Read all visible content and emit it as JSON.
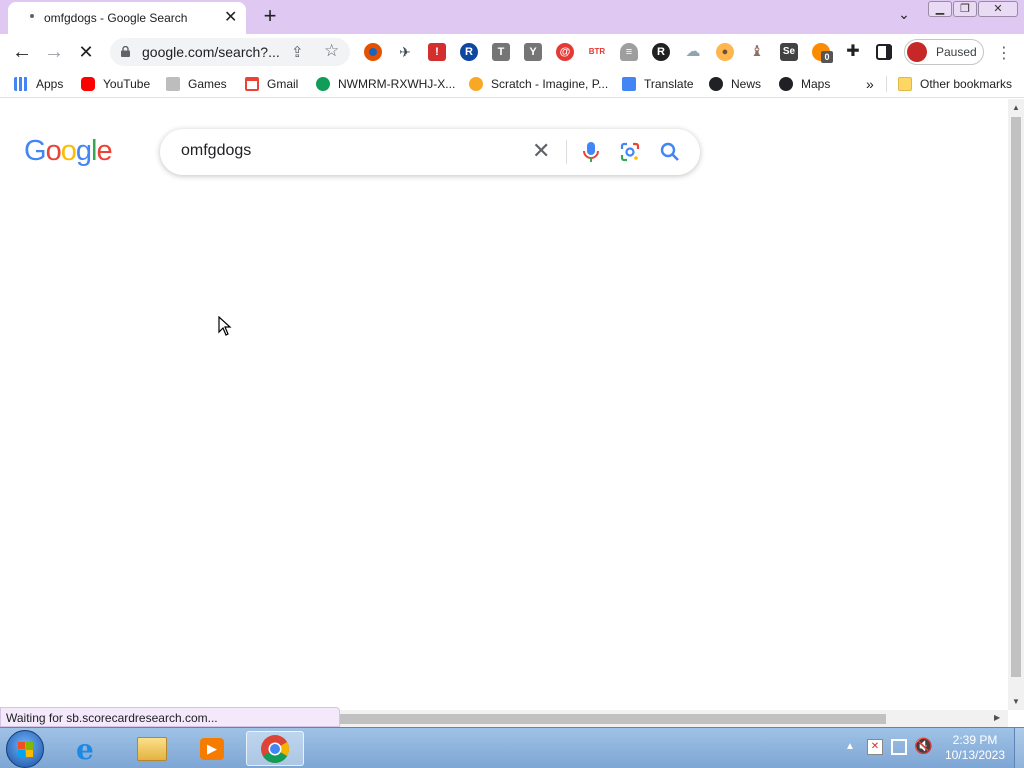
{
  "browser": {
    "tab": {
      "title": "omfgdogs - Google Search",
      "close_glyph": "✕"
    },
    "new_tab_glyph": "+",
    "tab_search_glyph": "⌄",
    "address": {
      "url": "google.com/search?..."
    },
    "profile": {
      "label": "Paused"
    },
    "extensions": [
      "eye-extension",
      "vimeo-extension",
      "red-alert-extension",
      "r-circle-extension",
      "t-extension",
      "y-extension",
      "red-swirl-extension",
      "btr-extension",
      "stack-extension",
      "r-black-extension",
      "cloud-extension",
      "cookie-extension",
      "chess-extension",
      "selenium-extension",
      "badge-extension",
      "puzzle-icon",
      "side-panel-icon"
    ],
    "extension_badge": "0",
    "selenium_label": "Se",
    "btr_label": "BTR",
    "t_label": "T",
    "y_label": "Y",
    "r_label": "R"
  },
  "bookmarks": {
    "items": [
      {
        "label": "Apps",
        "icon": "apps-grid-icon",
        "color": "#4285f4"
      },
      {
        "label": "YouTube",
        "icon": "youtube-icon",
        "color": "#ff0000"
      },
      {
        "label": "Games",
        "icon": "games-icon",
        "color": "#9e9e9e"
      },
      {
        "label": "Gmail",
        "icon": "gmail-icon",
        "color": "#ea4335"
      },
      {
        "label": "NWMRM-RXWHJ-X...",
        "icon": "phone-icon",
        "color": "#0f9d58"
      },
      {
        "label": "Scratch - Imagine, P...",
        "icon": "scratch-icon",
        "color": "#f9a825"
      },
      {
        "label": "Translate",
        "icon": "translate-icon",
        "color": "#4285f4"
      },
      {
        "label": "News",
        "icon": "globe-icon",
        "color": "#202124"
      },
      {
        "label": "Maps",
        "icon": "globe-icon",
        "color": "#202124"
      }
    ],
    "overflow": "»",
    "other": "Other bookmarks"
  },
  "google": {
    "logo_letters": [
      "G",
      "o",
      "o",
      "g",
      "l",
      "e"
    ],
    "logo_colors": [
      "#4285f4",
      "#ea4335",
      "#fbbc05",
      "#4285f4",
      "#34a853",
      "#ea4335"
    ],
    "query": "omfgdogs"
  },
  "status_text": "Waiting for sb.scorecardresearch.com...",
  "taskbar": {
    "time": "2:39 PM",
    "date": "10/13/2023"
  }
}
